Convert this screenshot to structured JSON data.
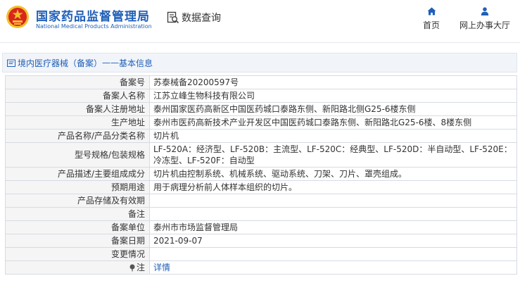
{
  "header": {
    "brand_cn": "国家药品监督管理局",
    "brand_en": "National Medical Products Administration",
    "query_label": "数据查询",
    "nav": {
      "home": "首页",
      "office": "网上办事大厅"
    }
  },
  "breadcrumb": {
    "category": "境内医疗器械（备案）",
    "separator": "——",
    "page": "基本信息"
  },
  "record": [
    {
      "label": "备案号",
      "value": "苏泰械备20200597号"
    },
    {
      "label": "备案人名称",
      "value": "江苏立峰生物科技有限公司"
    },
    {
      "label": "备案人注册地址",
      "value": "泰州国家医药高新区中国医药城口泰路东侧、新阳路北侧G25-6楼东侧"
    },
    {
      "label": "生产地址",
      "value": "泰州市医药高新技术产业开发区中国医药城口泰路东侧、新阳路北G25-6楼、8楼东侧"
    },
    {
      "label": "产品名称/产品分类名称",
      "value": "切片机"
    },
    {
      "label": "型号规格/包装规格",
      "value": "LF-520A：经济型、LF-520B：主流型、LF-520C：经典型、LF-520D：半自动型、LF-520E：冷冻型、LF-520F：自动型"
    },
    {
      "label": "产品描述/主要组成成分",
      "value": "切片机由控制系统、机械系统、驱动系统、刀架、刀片、罩壳组成。"
    },
    {
      "label": "预期用途",
      "value": "用于病理分析前人体样本组织的切片。"
    },
    {
      "label": "产品存储及有效期",
      "value": ""
    },
    {
      "label": "备注",
      "value": ""
    },
    {
      "label": "备案单位",
      "value": "泰州市市场监督管理局"
    },
    {
      "label": "备案日期",
      "value": "2021-09-07"
    },
    {
      "label": "变更情况",
      "value": ""
    },
    {
      "label": "注",
      "value": "详情"
    }
  ],
  "colors": {
    "brand_blue": "#1f5fb8",
    "logo_red": "#d9261c",
    "logo_gold": "#f2c12e",
    "label_bg": "#f5f5f5",
    "border": "#d6dbe3"
  },
  "icons": {
    "logo": "emblem-logo",
    "query": "search-document-icon",
    "home": "home-icon",
    "office": "user-icon",
    "breadcrumb": "folder-icon",
    "note": "pin-icon"
  }
}
